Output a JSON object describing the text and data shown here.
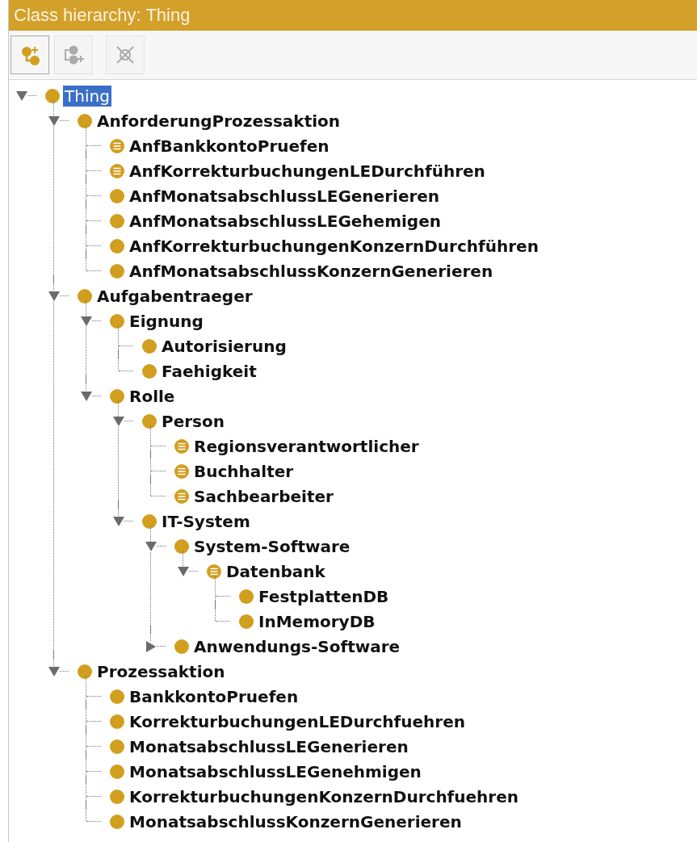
{
  "panel": {
    "title": "Class hierarchy: Thing"
  },
  "toolbar": [
    {
      "kind": "add-subclass",
      "disabled": false
    },
    {
      "kind": "add-sibling",
      "disabled": true
    },
    {
      "kind": "delete",
      "disabled": true
    }
  ],
  "tree": [
    {
      "label": "Thing",
      "kind": "root",
      "selected": true,
      "expanded": true,
      "children": [
        {
          "label": "AnforderungProzessaktion",
          "kind": "primitive",
          "selected": false,
          "expanded": true,
          "children": [
            {
              "label": "AnfBankkontoPruefen",
              "kind": "defined",
              "selected": false
            },
            {
              "label": "AnfKorrekturbuchungenLEDurchführen",
              "kind": "defined",
              "selected": false
            },
            {
              "label": "AnfMonatsabschlussLEGenerieren",
              "kind": "primitive",
              "selected": false
            },
            {
              "label": "AnfMonatsabschlussLEGehemigen",
              "kind": "primitive",
              "selected": false
            },
            {
              "label": "AnfKorrekturbuchungenKonzernDurchführen",
              "kind": "primitive",
              "selected": false
            },
            {
              "label": "AnfMonatsabschlussKonzernGenerieren",
              "kind": "primitive",
              "selected": false
            }
          ]
        },
        {
          "label": "Aufgabentraeger",
          "kind": "primitive",
          "selected": false,
          "expanded": true,
          "children": [
            {
              "label": "Eignung",
              "kind": "primitive",
              "selected": false,
              "expanded": true,
              "children": [
                {
                  "label": "Autorisierung",
                  "kind": "primitive",
                  "selected": false
                },
                {
                  "label": "Faehigkeit",
                  "kind": "primitive",
                  "selected": false
                }
              ]
            },
            {
              "label": "Rolle",
              "kind": "primitive",
              "selected": false,
              "expanded": true,
              "children": [
                {
                  "label": "Person",
                  "kind": "primitive",
                  "selected": false,
                  "expanded": true,
                  "children": [
                    {
                      "label": "Regionsverantwortlicher",
                      "kind": "defined",
                      "selected": false
                    },
                    {
                      "label": "Buchhalter",
                      "kind": "defined",
                      "selected": false
                    },
                    {
                      "label": "Sachbearbeiter",
                      "kind": "defined",
                      "selected": false
                    }
                  ]
                },
                {
                  "label": "IT-System",
                  "kind": "primitive",
                  "selected": false,
                  "expanded": true,
                  "children": [
                    {
                      "label": "System-Software",
                      "kind": "primitive",
                      "selected": false,
                      "expanded": true,
                      "children": [
                        {
                          "label": "Datenbank",
                          "kind": "defined",
                          "selected": false,
                          "expanded": true,
                          "children": [
                            {
                              "label": "FestplattenDB",
                              "kind": "primitive",
                              "selected": false
                            },
                            {
                              "label": "InMemoryDB",
                              "kind": "primitive",
                              "selected": false
                            }
                          ]
                        }
                      ]
                    },
                    {
                      "label": "Anwendungs-Software",
                      "kind": "primitive",
                      "selected": false,
                      "expanded": false
                    }
                  ]
                }
              ]
            }
          ]
        },
        {
          "label": "Prozessaktion",
          "kind": "primitive",
          "selected": false,
          "expanded": true,
          "children": [
            {
              "label": "BankkontoPruefen",
              "kind": "primitive",
              "selected": false
            },
            {
              "label": "KorrekturbuchungenLEDurchfuehren",
              "kind": "primitive",
              "selected": false
            },
            {
              "label": "MonatsabschlussLEGenerieren",
              "kind": "primitive",
              "selected": false
            },
            {
              "label": "MonatsabschlussLEGenehmigen",
              "kind": "primitive",
              "selected": false
            },
            {
              "label": "KorrekturbuchungenKonzernDurchfuehren",
              "kind": "primitive",
              "selected": false
            },
            {
              "label": "MonatsabschlussKonzernGenerieren",
              "kind": "primitive",
              "selected": false
            }
          ]
        }
      ]
    }
  ]
}
